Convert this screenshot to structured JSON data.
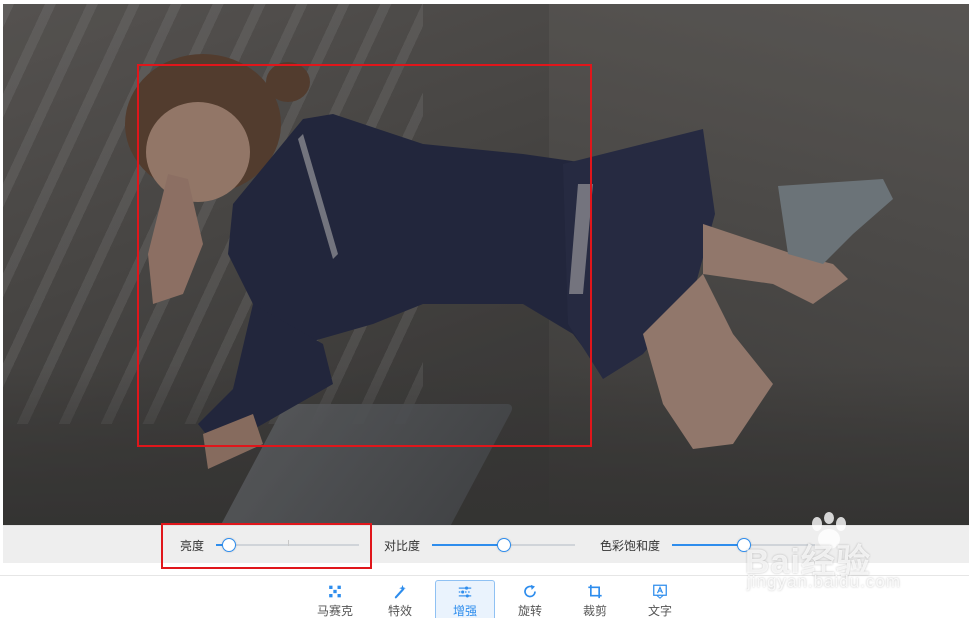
{
  "sliders": [
    {
      "label": "亮度",
      "value_pct": 9
    },
    {
      "label": "对比度",
      "value_pct": 50
    },
    {
      "label": "色彩饱和度",
      "value_pct": 50
    }
  ],
  "toolbar": {
    "items": [
      {
        "label": "马赛克",
        "icon": "mosaic-icon"
      },
      {
        "label": "特效",
        "icon": "magic-wand-icon"
      },
      {
        "label": "增强",
        "icon": "sliders-icon",
        "active": true
      },
      {
        "label": "旋转",
        "icon": "rotate-icon"
      },
      {
        "label": "裁剪",
        "icon": "crop-icon"
      },
      {
        "label": "文字",
        "icon": "text-icon"
      }
    ]
  },
  "watermark": {
    "brand": "Bai经验",
    "url": "jingyan.baidu.com"
  },
  "colors": {
    "accent": "#2e8ded",
    "highlight": "#e0161b",
    "adjust_bar_bg": "#eeeeee"
  }
}
